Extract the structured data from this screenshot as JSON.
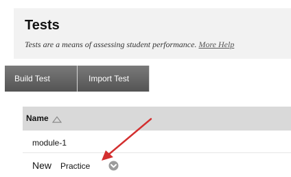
{
  "header": {
    "title": "Tests",
    "description": "Tests are a means of assessing student performance.",
    "help_link": "More Help"
  },
  "toolbar": {
    "build_label": "Build Test",
    "import_label": "Import Test"
  },
  "table": {
    "column_name": "Name",
    "rows": [
      {
        "label": "module-1"
      },
      {
        "new_label": "New",
        "label": "Practice"
      }
    ]
  },
  "colors": {
    "button_gradient_top": "#7a7a7a",
    "button_gradient_bottom": "#545454",
    "header_bg": "#f2f2f2",
    "table_header_bg": "#d9d9d9",
    "annotation_arrow": "#d32f2f"
  },
  "icons": {
    "sort": "sort-ascending-icon",
    "row_menu": "chevron-down-icon",
    "annotation": "red-arrow-icon"
  }
}
